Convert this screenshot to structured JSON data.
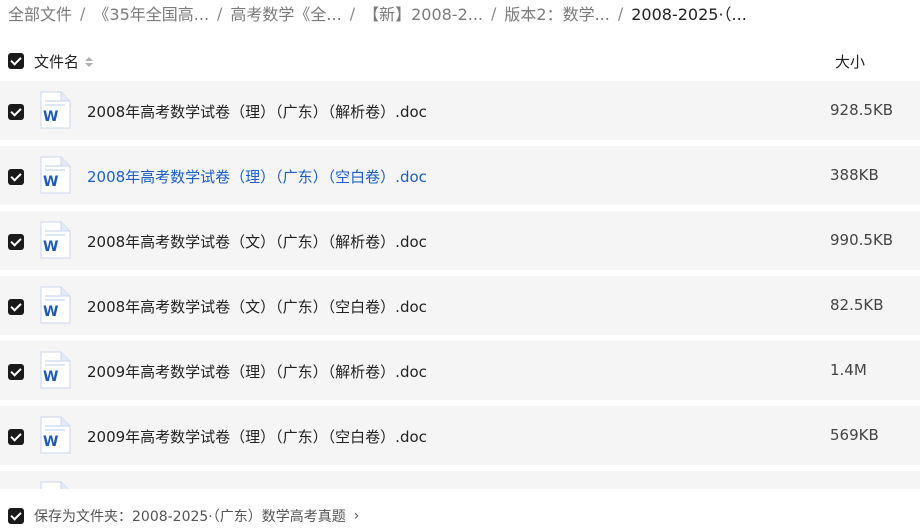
{
  "breadcrumb": [
    {
      "label": "全部文件",
      "current": false
    },
    {
      "label": "《35年全国高...",
      "current": false
    },
    {
      "label": "高考数学《全...",
      "current": false
    },
    {
      "label": "【新】2008-2...",
      "current": false
    },
    {
      "label": "版本2：数学...",
      "current": false
    },
    {
      "label": "2008-2025·（...",
      "current": true
    }
  ],
  "breadcrumb_separator": "/",
  "header": {
    "name_label": "文件名",
    "size_label": "大小"
  },
  "files": [
    {
      "name": "2008年高考数学试卷（理）（广东）（解析卷）.doc",
      "size": "928.5KB",
      "highlight": false
    },
    {
      "name": "2008年高考数学试卷（理）（广东）（空白卷）.doc",
      "size": "388KB",
      "highlight": true
    },
    {
      "name": "2008年高考数学试卷（文）（广东）（解析卷）.doc",
      "size": "990.5KB",
      "highlight": false
    },
    {
      "name": "2008年高考数学试卷（文）（广东）（空白卷）.doc",
      "size": "82.5KB",
      "highlight": false
    },
    {
      "name": "2009年高考数学试卷（理）（广东）（解析卷）.doc",
      "size": "1.4M",
      "highlight": false
    },
    {
      "name": "2009年高考数学试卷（理）（广东）（空白卷）.doc",
      "size": "569KB",
      "highlight": false
    }
  ],
  "footer": {
    "save_label": "保存为文件夹：2008-2025·（广东）数学高考真题",
    "chevron": "›"
  },
  "icons": {
    "file_icon": "word-document-icon",
    "checkbox": "checked-checkbox-icon",
    "sort": "sort-icon"
  },
  "colors": {
    "row_bg": "#f5f5f6",
    "highlight_text": "#1a5fc7",
    "word_blue": "#1e5bb8",
    "checkbox": "#1a1a1a"
  }
}
